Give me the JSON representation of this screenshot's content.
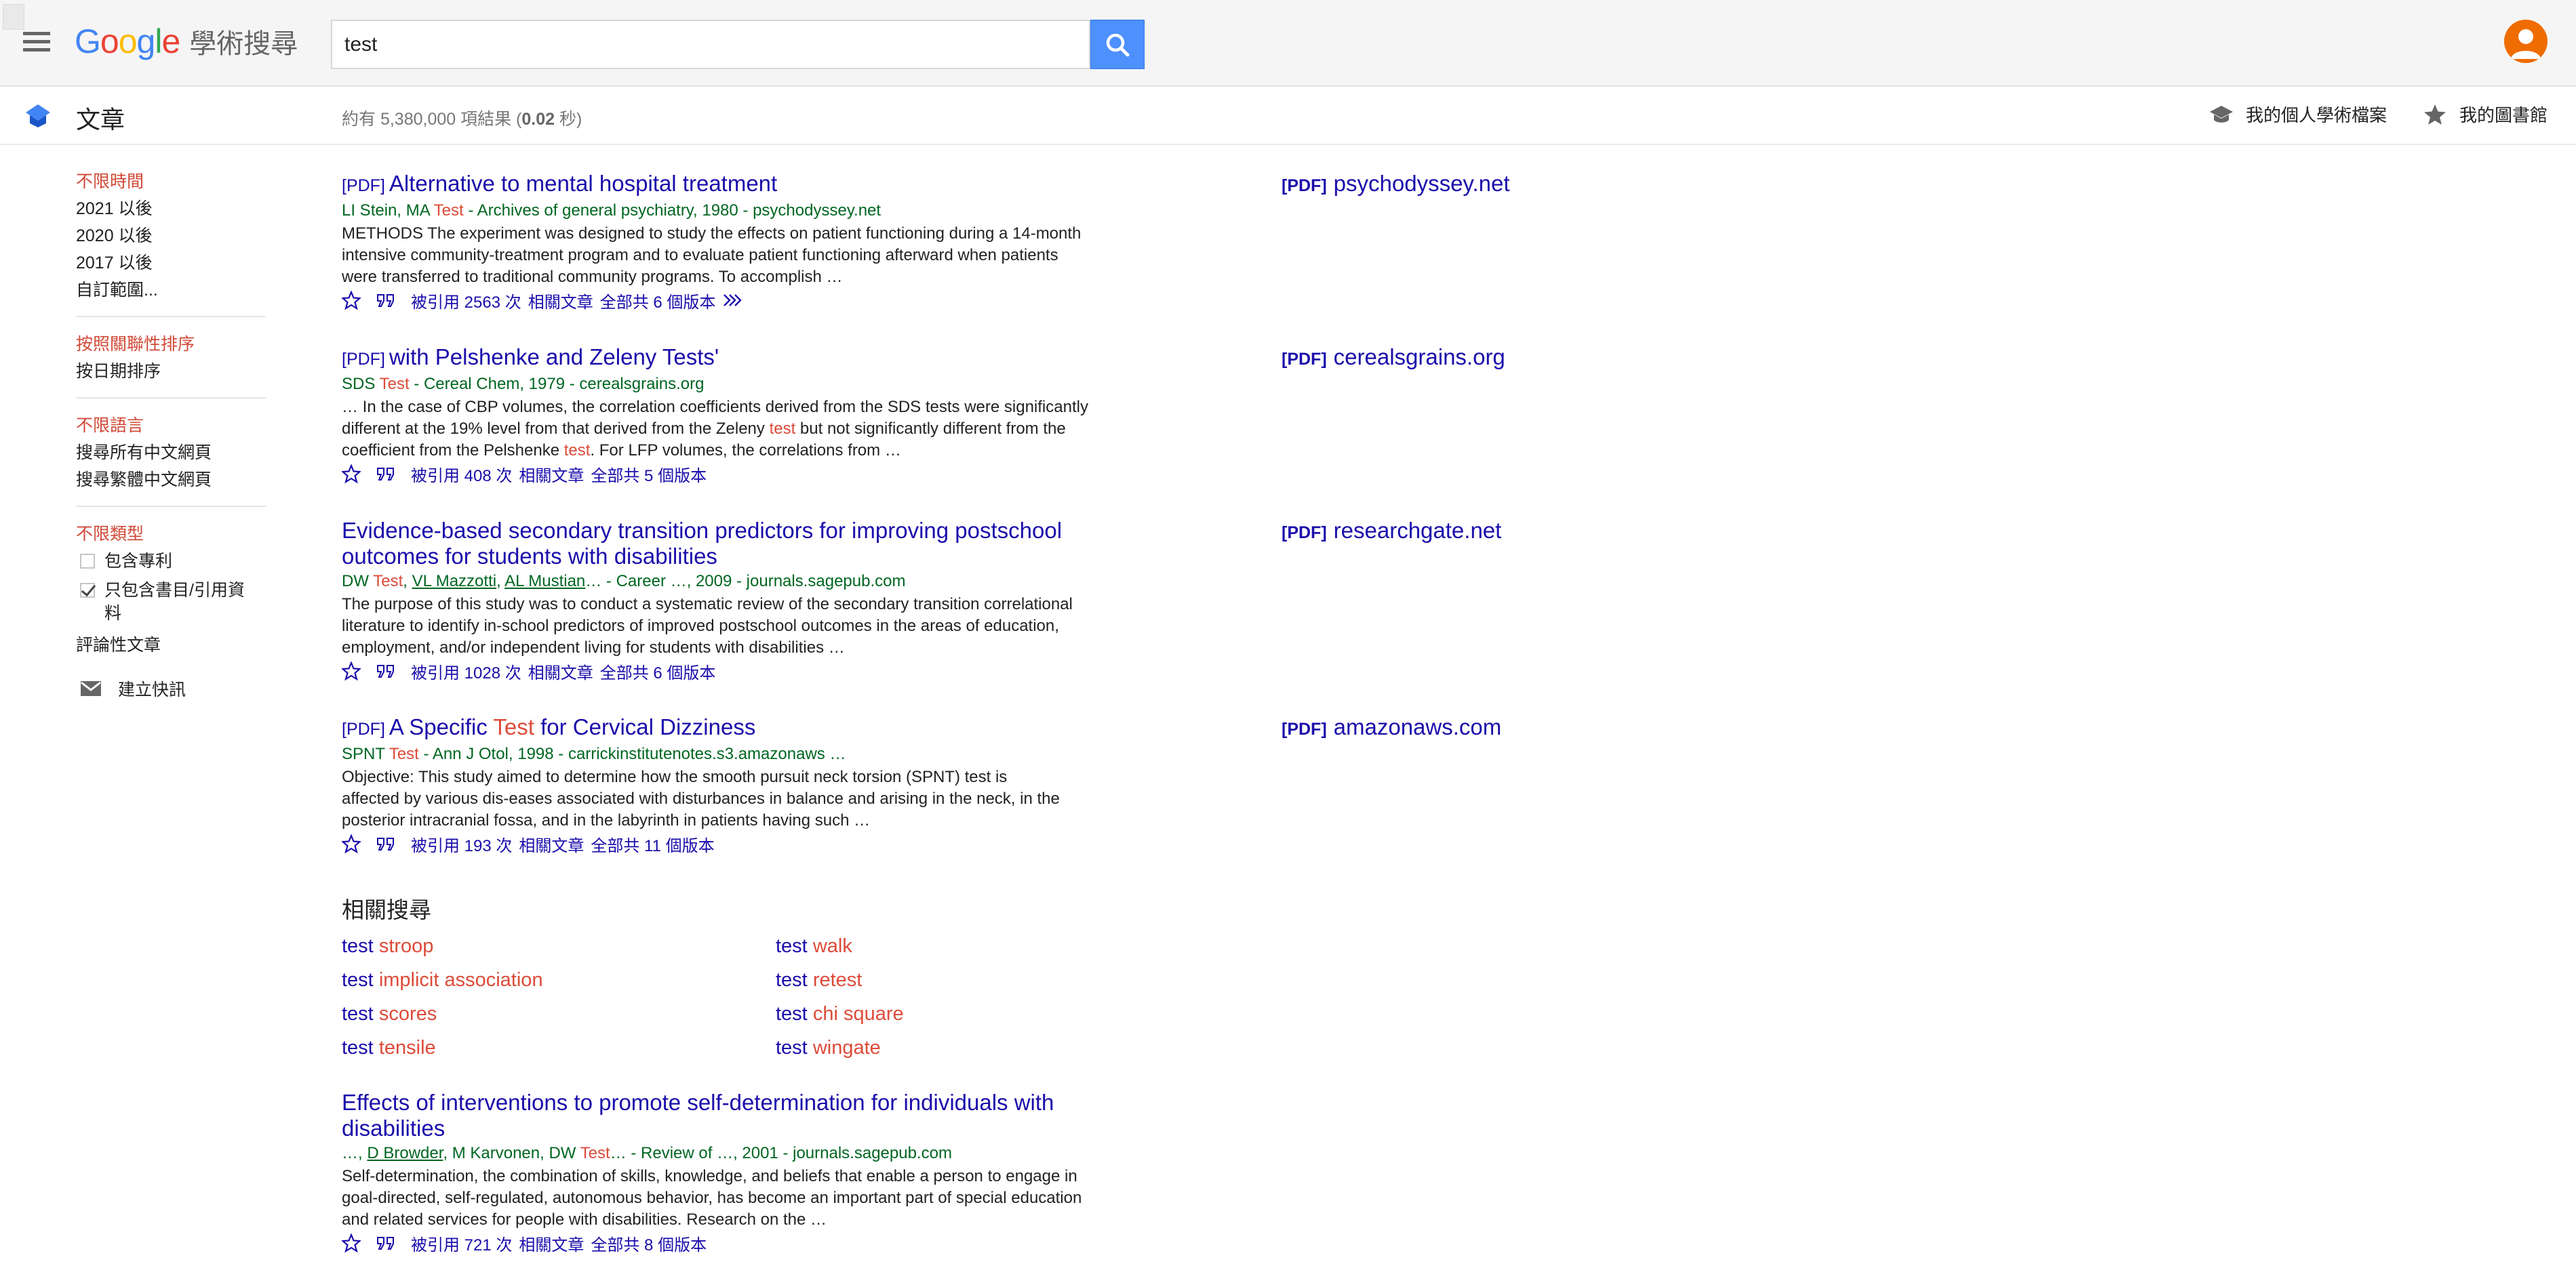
{
  "header": {
    "logo_text": "Google",
    "logo_suffix": "學術搜尋",
    "search": {
      "value": "test",
      "placeholder": ""
    }
  },
  "subbar": {
    "section_label": "文章",
    "result_count_prefix": "約有 5,380,000 項結果 (",
    "result_time": "0.02",
    "result_count_suffix": " 秒)",
    "profile_link": "我的個人學術檔案",
    "library_link": "我的圖書館"
  },
  "sidebar": {
    "time": [
      "不限時間",
      "2021 以後",
      "2020 以後",
      "2017 以後",
      "自訂範圍..."
    ],
    "sort": [
      "按照關聯性排序",
      "按日期排序"
    ],
    "language": [
      "不限語言",
      "搜尋所有中文網頁",
      "搜尋繁體中文網頁"
    ],
    "type_label": "不限類型",
    "include_patents": "包含專利",
    "include_citations": "只包含書目/引用資料",
    "review_articles": "評論性文章",
    "create_alert": "建立快訊"
  },
  "results": [
    {
      "tag": "[PDF]",
      "title": "Alternative to mental hospital treatment",
      "meta_a": "LI Stein, MA ",
      "meta_hl": "Test",
      "meta_b": " - Archives of general psychiatry, 1980 - psychodyssey.net",
      "snippet": "METHODS The experiment was designed to study the effects on patient functioning during a 14-month intensive community-treatment program and to evaluate patient functioning afterward when patients were transferred to traditional community programs. To accomplish …",
      "cited": "被引用 2563 次",
      "related": "相關文章",
      "versions": "全部共 6 個版本",
      "side_tag": "[PDF]",
      "side_domain": "psychodyssey.net"
    },
    {
      "tag": "[PDF]",
      "title": "with Pelshenke and Zeleny Tests'",
      "meta_a": "SDS ",
      "meta_hl": "Test",
      "meta_b": " - Cereal Chem, 1979 - cerealsgrains.org",
      "snippet_a": "… In the case of CBP volumes, the correlation coefficients derived from the SDS tests were significantly different at the 19% level from that derived from the Zeleny ",
      "snippet_hl1": "test",
      "snippet_b": " but not significantly different from the coefficient from the Pelshenke ",
      "snippet_hl2": "test",
      "snippet_c": ". For LFP volumes, the correlations from …",
      "cited": "被引用 408 次",
      "related": "相關文章",
      "versions": "全部共 5 個版本",
      "side_tag": "[PDF]",
      "side_domain": "cerealsgrains.org"
    },
    {
      "title": "Evidence-based secondary transition predictors for improving postschool outcomes for students with disabilities",
      "meta_a": "DW ",
      "meta_hl": "Test",
      "meta_author1": "VL Mazzotti",
      "meta_author2": "AL Mustian",
      "meta_b": "… - Career …, 2009 - journals.sagepub.com",
      "snippet": "The purpose of this study was to conduct a systematic review of the secondary transition correlational literature to identify in-school predictors of improved postschool outcomes in the areas of education, employment, and/or independent living for students with disabilities …",
      "cited": "被引用 1028 次",
      "related": "相關文章",
      "versions": "全部共 6 個版本",
      "side_tag": "[PDF]",
      "side_domain": "researchgate.net"
    },
    {
      "tag": "[PDF]",
      "title_a": "A Specific ",
      "title_hl": "Test",
      "title_b": " for Cervical Dizziness",
      "meta_a": "SPNT ",
      "meta_hl": "Test",
      "meta_b": " - Ann J Otol, 1998 - carrickinstitutenotes.s3.amazonaws …",
      "snippet": "Objective: This study aimed to determine how the smooth pursuit neck torsion (SPNT) test is affected by various dis-eases associated with disturbances in balance and arising in the neck, in the posterior intracranial fossa, and in the labyrinth in patients having such …",
      "cited": "被引用 193 次",
      "related": "相關文章",
      "versions": "全部共 11 個版本",
      "side_tag": "[PDF]",
      "side_domain": "amazonaws.com"
    },
    {
      "title": "Effects of interventions to promote self-determination for individuals with disabilities",
      "meta_a": "…, ",
      "meta_author1": "D Browder",
      "meta_mid": ", M Karvonen, DW ",
      "meta_hl": "Test",
      "meta_b": "… - Review of …, 2001 - journals.sagepub.com",
      "snippet": "Self-determination, the combination of skills, knowledge, and beliefs that enable a person to engage in goal-directed, self-regulated, autonomous behavior, has become an important part of special education and related services for people with disabilities. Research on the …",
      "cited": "被引用 721 次",
      "related": "相關文章",
      "versions": "全部共 8 個版本"
    }
  ],
  "related_searches": {
    "heading": "相關搜尋",
    "items": [
      {
        "q": "test",
        "h": "stroop"
      },
      {
        "q": "test",
        "h": "walk"
      },
      {
        "q": "test",
        "h": "implicit association"
      },
      {
        "q": "test",
        "h": "retest"
      },
      {
        "q": "test",
        "h": "scores"
      },
      {
        "q": "test",
        "h": "chi square"
      },
      {
        "q": "test",
        "h": "tensile"
      },
      {
        "q": "test",
        "h": "wingate"
      }
    ]
  },
  "colors": {
    "link": "#1a0dab",
    "highlight": "#dd4b39",
    "meta_green": "#006621",
    "search_button": "#4d90fe",
    "avatar": "#ef6c00"
  },
  "icons": [
    "menu-icon",
    "search-icon",
    "avatar-icon",
    "articles-icon",
    "scholar-cap-icon",
    "star-icon",
    "quote-icon",
    "scholar-link-icon",
    "mail-icon",
    "checkbox-icon"
  ]
}
